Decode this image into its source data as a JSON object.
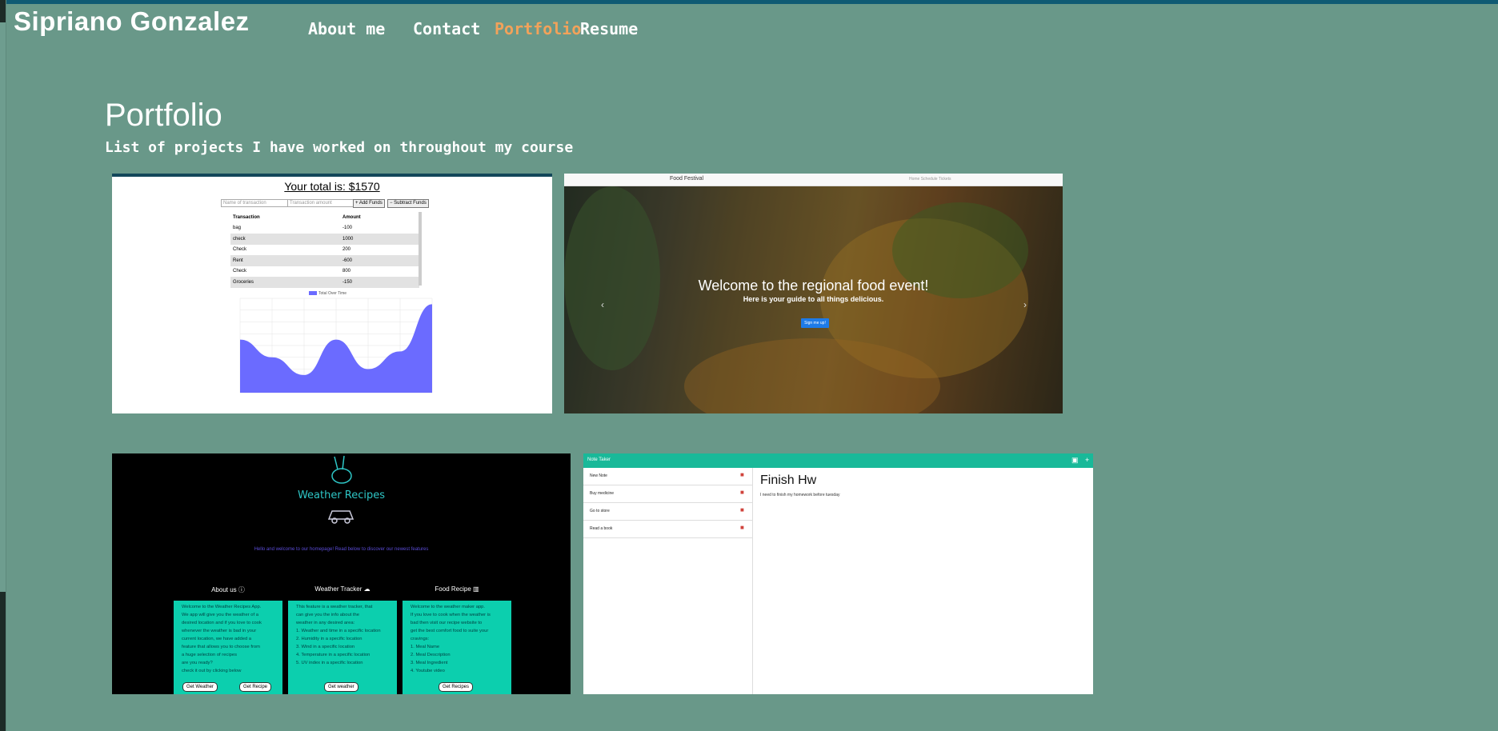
{
  "site": {
    "title": "Sipriano Gonzalez"
  },
  "nav": {
    "items": [
      {
        "label": "About me"
      },
      {
        "label": "Contact"
      },
      {
        "label": "Portfolio",
        "active": true
      },
      {
        "label": "Resume"
      }
    ],
    "active_color": "#f2a25a"
  },
  "colors": {
    "background": "#699889",
    "topbar": "#0f5a73",
    "text": "#ffffff"
  },
  "portfolio": {
    "heading": "Portfolio",
    "subheading": "List of projects I have worked on throughout my course",
    "projects": [
      {
        "total": "Your total is: $1570",
        "name_placeholder": "Name of transaction",
        "amount_placeholder": "Transaction amount",
        "add_label": "+ Add Funds",
        "subtract_label": "− Subtract Funds",
        "columns": [
          "Transaction",
          "Amount"
        ],
        "rows": [
          [
            "bag",
            "-100"
          ],
          [
            "check",
            "1000"
          ],
          [
            "Check",
            "200"
          ],
          [
            "Rent",
            "-600"
          ],
          [
            "Check",
            "800"
          ],
          [
            "Groceries",
            "-150"
          ]
        ],
        "legend": "Total Over Time",
        "chart_data": {
          "type": "area",
          "series": [
            {
              "name": "Total Over Time",
              "values": [
                900,
                600,
                300,
                900,
                400,
                700,
                1500
              ]
            }
          ]
        }
      },
      {
        "brand": "Food Festival",
        "nav_links": "Home  Schedule  Tickets",
        "headline": "Welcome to the regional food event!",
        "tagline": "Here is your guide to all things delicious.",
        "cta": "Sign me up!"
      },
      {
        "title": "Weather Recipes",
        "welcome": "Hello and welcome to our homepage! Read below to discover our newest features",
        "cards": [
          {
            "heading": "About us",
            "lines": [
              "Welcome to the Weather Recipes App.",
              "We app will give you the weather of a",
              "desired location and if you love to cook",
              "whenever the weather is bad in your",
              "current location, we have added a",
              "feature that allows you to choose from",
              "a huge selection of recipes",
              "are you ready?",
              "check it out by clicking below"
            ],
            "buttons": [
              "Get Weather",
              "Get Recipe"
            ]
          },
          {
            "heading": "Weather Tracker",
            "lines": [
              "This feature is a weather tracker, that",
              "can give you the info about the",
              "weather in any desired area:",
              "1. Weather and time in a specific location",
              "2. Humidity in a specific location",
              "3. Wind in a specific location",
              "4. Temperature in a specific location",
              "5. UV index in a specific location"
            ],
            "buttons": [
              "Get weather"
            ]
          },
          {
            "heading": "Food Recipe",
            "lines": [
              "Welcome to the weather maker app.",
              "If you love to cook when the weather is",
              "bad then visit our recipe website to",
              "get the best comfort food to suite your",
              "cravings:",
              "1. Meal Name",
              "2. Meal Description",
              "3. Meal Ingredient",
              "4. Youtube video"
            ],
            "buttons": [
              "Get Recipes"
            ]
          }
        ]
      },
      {
        "app": "Note Taker",
        "notes": [
          "New Note",
          "Buy medicine",
          "Go to store",
          "Read a book"
        ],
        "active_title": "Finish Hw",
        "active_text": "I need to finish my homework before tuesday"
      }
    ]
  }
}
